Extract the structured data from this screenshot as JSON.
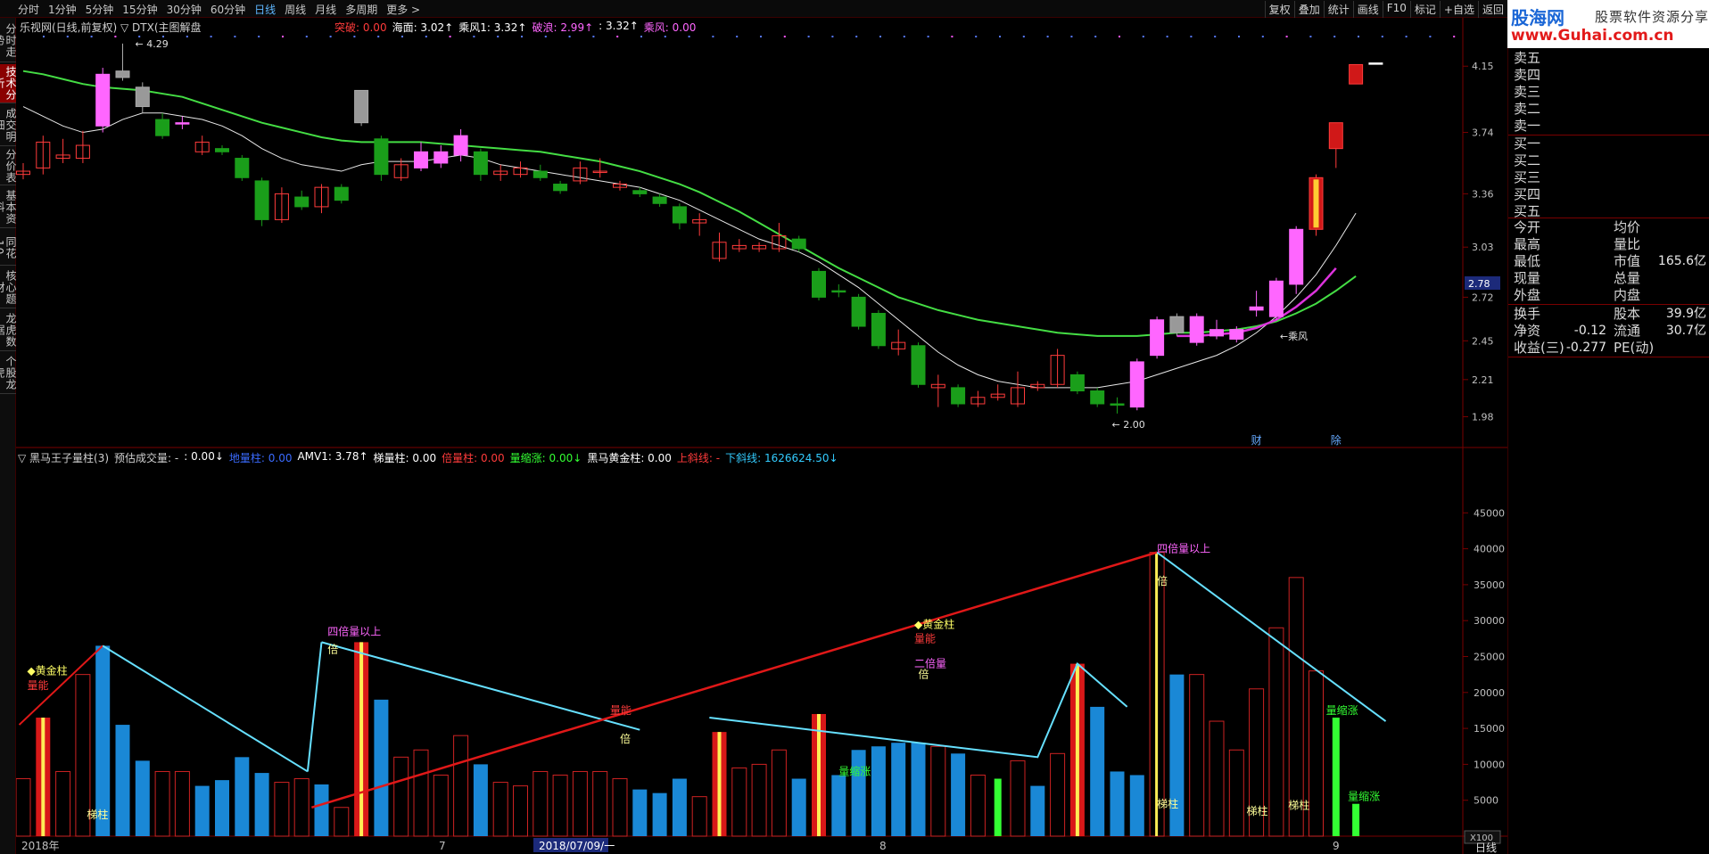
{
  "toolbar": {
    "periods": [
      "分时",
      "1分钟",
      "5分钟",
      "15分钟",
      "30分钟",
      "60分钟",
      "日线",
      "周线",
      "月线",
      "多周期",
      "更多 >"
    ],
    "active_period": "日线",
    "right": [
      "复权",
      "叠加",
      "统计",
      "画线",
      "F10",
      "标记",
      "+自选",
      "返回"
    ]
  },
  "logo": {
    "brand": "股海网",
    "sub": "股票软件资源分享",
    "url": "www.Guhai.com.cn"
  },
  "side_tabs": [
    "分时走势",
    "技术分析",
    "成交明细",
    "分价表",
    "基本资料",
    "同花10",
    "核心题材",
    "龙虎数据",
    "个股龙虎"
  ],
  "active_side_tab": "技术分析",
  "main": {
    "title": "乐视网(日线,前复权) ▽ DTX(主图解盘",
    "legend": [
      {
        "text": "突破: 0.00",
        "color": "#ff3b3b"
      },
      {
        "text": "海面: 3.02↑",
        "color": "#ffffff"
      },
      {
        "text": "乘风1: 3.32↑",
        "color": "#ffffff"
      },
      {
        "text": "破浪: 2.99↑",
        "color": "#ff66ff"
      },
      {
        "text": ": 3.32↑",
        "color": "#ffffff"
      },
      {
        "text": "乘风: 0.00",
        "color": "#ff66ff"
      }
    ],
    "high_label": "4.29",
    "low_label": "2.00",
    "chengfeng_label": "乘风",
    "markers": [
      "财",
      "除"
    ],
    "price_ticks": [
      "4.15",
      "3.74",
      "3.36",
      "3.03",
      "2.72",
      "2.45",
      "2.21",
      "1.98"
    ],
    "current_price": "2.78"
  },
  "sub": {
    "legend": [
      {
        "text": "▽ 黑马王子量柱(3)",
        "color": "#d0d0d0"
      },
      {
        "text": "预估成交量: -",
        "color": "#d0d0d0"
      },
      {
        "text": ": 0.00↓",
        "color": "#ffffff"
      },
      {
        "text": "地量柱: 0.00",
        "color": "#3a6bff"
      },
      {
        "text": "AMV1: 3.78↑",
        "color": "#ffffff"
      },
      {
        "text": "梯量柱: 0.00",
        "color": "#ffffff"
      },
      {
        "text": "倍量柱: 0.00",
        "color": "#ff3b3b"
      },
      {
        "text": "量缩涨: 0.00↓",
        "color": "#33ff33"
      },
      {
        "text": "黑马黄金柱: 0.00",
        "color": "#ffffff"
      },
      {
        "text": "上斜线: -",
        "color": "#ff3b3b"
      },
      {
        "text": "下斜线: 1626624.50↓",
        "color": "#33ccff"
      }
    ],
    "vol_ticks": [
      "45000",
      "40000",
      "35000",
      "30000",
      "25000",
      "20000",
      "15000",
      "10000",
      "5000"
    ],
    "unit": "X100",
    "annotations": [
      {
        "text": "◆黄金柱",
        "color": "#ffff66"
      },
      {
        "text": "量能",
        "color": "#ff3b3b"
      },
      {
        "text": "梯柱",
        "color": "#ffff99"
      },
      {
        "text": "四倍量以上",
        "color": "#ff66ff"
      },
      {
        "text": "倍",
        "color": "#ffff99"
      },
      {
        "text": "量能",
        "color": "#ff3b3b"
      },
      {
        "text": "倍",
        "color": "#ffff99"
      },
      {
        "text": "量缩涨",
        "color": "#33ff33"
      },
      {
        "text": "◆黄金柱",
        "color": "#ffff66"
      },
      {
        "text": "量能",
        "color": "#ff3b3b"
      },
      {
        "text": "二倍量",
        "color": "#ff66ff"
      },
      {
        "text": "倍",
        "color": "#ffff99"
      },
      {
        "text": "四倍量以上",
        "color": "#ff66ff"
      },
      {
        "text": "倍",
        "color": "#ffff99"
      },
      {
        "text": "梯柱",
        "color": "#ffff99"
      },
      {
        "text": "梯柱",
        "color": "#ffff99"
      },
      {
        "text": "梯柱",
        "color": "#ffff99"
      },
      {
        "text": "量缩涨",
        "color": "#33ff33"
      },
      {
        "text": "量缩涨",
        "color": "#33ff33"
      }
    ]
  },
  "date_axis": {
    "labels": [
      "2018年",
      "7",
      "2018/07/09/一",
      "8",
      "9"
    ],
    "corner": "日线"
  },
  "orderbook": {
    "asks": [
      "卖五",
      "卖四",
      "卖三",
      "卖二",
      "卖一"
    ],
    "bids": [
      "买一",
      "买二",
      "买三",
      "买四",
      "买五"
    ]
  },
  "stats": {
    "left_a": [
      "今开",
      "最高",
      "最低",
      "现量",
      "外盘"
    ],
    "right_a": [
      "均价",
      "量比",
      "市值",
      "总量",
      "内盘"
    ],
    "right_a_vals": [
      "",
      "",
      "165.6亿",
      "",
      ""
    ],
    "left_b": [
      "换手",
      "净资",
      "收益(三)"
    ],
    "left_b_vals": [
      "",
      "-0.12",
      "-0.277"
    ],
    "right_b": [
      "股本",
      "流通",
      "PE(动)"
    ],
    "right_b_vals": [
      "39.9亿",
      "30.7亿",
      ""
    ]
  },
  "colors": {
    "up": "#ff3b3b",
    "down": "#1a9e1a",
    "pink": "#ff66ff",
    "ma_green": "#44dd44",
    "ma_white": "#e8e8e8",
    "ma_pink": "#dd33dd",
    "vol_blue": "#1a88d6",
    "vol_red": "#cc2222",
    "trend_red": "#e01818",
    "trend_cyan": "#66e0ff"
  },
  "chart_data": {
    "type": "candlestick",
    "ylim": [
      1.9,
      4.35
    ],
    "candles": [
      {
        "o": 3.48,
        "c": 3.5,
        "h": 3.55,
        "l": 3.45,
        "t": "up"
      },
      {
        "o": 3.52,
        "c": 3.68,
        "h": 3.72,
        "l": 3.48,
        "t": "up"
      },
      {
        "o": 3.6,
        "c": 3.58,
        "h": 3.7,
        "l": 3.55,
        "t": "up"
      },
      {
        "o": 3.58,
        "c": 3.66,
        "h": 3.75,
        "l": 3.55,
        "t": "up"
      },
      {
        "o": 3.78,
        "c": 4.1,
        "h": 4.14,
        "l": 3.74,
        "t": "pink"
      },
      {
        "o": 4.08,
        "c": 4.12,
        "h": 4.29,
        "l": 4.06,
        "t": "gray"
      },
      {
        "o": 4.02,
        "c": 3.9,
        "h": 4.05,
        "l": 3.86,
        "t": "gray"
      },
      {
        "o": 3.82,
        "c": 3.72,
        "h": 3.86,
        "l": 3.7,
        "t": "down"
      },
      {
        "o": 3.8,
        "c": 3.8,
        "h": 3.84,
        "l": 3.76,
        "t": "pink"
      },
      {
        "o": 3.62,
        "c": 3.68,
        "h": 3.72,
        "l": 3.6,
        "t": "up"
      },
      {
        "o": 3.64,
        "c": 3.62,
        "h": 3.66,
        "l": 3.6,
        "t": "down"
      },
      {
        "o": 3.58,
        "c": 3.46,
        "h": 3.6,
        "l": 3.44,
        "t": "down"
      },
      {
        "o": 3.44,
        "c": 3.2,
        "h": 3.46,
        "l": 3.16,
        "t": "down"
      },
      {
        "o": 3.2,
        "c": 3.36,
        "h": 3.4,
        "l": 3.18,
        "t": "up"
      },
      {
        "o": 3.34,
        "c": 3.28,
        "h": 3.38,
        "l": 3.26,
        "t": "down"
      },
      {
        "o": 3.28,
        "c": 3.4,
        "h": 3.42,
        "l": 3.24,
        "t": "up"
      },
      {
        "o": 3.4,
        "c": 3.32,
        "h": 3.42,
        "l": 3.3,
        "t": "down"
      },
      {
        "o": 4.0,
        "c": 3.8,
        "h": 4.0,
        "l": 3.78,
        "t": "gray"
      },
      {
        "o": 3.7,
        "c": 3.48,
        "h": 3.72,
        "l": 3.44,
        "t": "down"
      },
      {
        "o": 3.46,
        "c": 3.54,
        "h": 3.58,
        "l": 3.44,
        "t": "up"
      },
      {
        "o": 3.52,
        "c": 3.62,
        "h": 3.68,
        "l": 3.5,
        "t": "pink"
      },
      {
        "o": 3.55,
        "c": 3.62,
        "h": 3.66,
        "l": 3.52,
        "t": "pink"
      },
      {
        "o": 3.6,
        "c": 3.72,
        "h": 3.76,
        "l": 3.56,
        "t": "pink"
      },
      {
        "o": 3.62,
        "c": 3.48,
        "h": 3.64,
        "l": 3.44,
        "t": "down"
      },
      {
        "o": 3.48,
        "c": 3.5,
        "h": 3.54,
        "l": 3.44,
        "t": "up"
      },
      {
        "o": 3.48,
        "c": 3.52,
        "h": 3.56,
        "l": 3.46,
        "t": "up"
      },
      {
        "o": 3.5,
        "c": 3.46,
        "h": 3.54,
        "l": 3.44,
        "t": "down"
      },
      {
        "o": 3.42,
        "c": 3.38,
        "h": 3.44,
        "l": 3.36,
        "t": "down"
      },
      {
        "o": 3.44,
        "c": 3.52,
        "h": 3.56,
        "l": 3.42,
        "t": "up"
      },
      {
        "o": 3.5,
        "c": 3.5,
        "h": 3.58,
        "l": 3.46,
        "t": "up"
      },
      {
        "o": 3.4,
        "c": 3.42,
        "h": 3.44,
        "l": 3.38,
        "t": "up"
      },
      {
        "o": 3.38,
        "c": 3.36,
        "h": 3.4,
        "l": 3.34,
        "t": "down"
      },
      {
        "o": 3.34,
        "c": 3.3,
        "h": 3.36,
        "l": 3.28,
        "t": "down"
      },
      {
        "o": 3.28,
        "c": 3.18,
        "h": 3.3,
        "l": 3.14,
        "t": "down"
      },
      {
        "o": 3.18,
        "c": 3.2,
        "h": 3.24,
        "l": 3.1,
        "t": "up"
      },
      {
        "o": 2.96,
        "c": 3.06,
        "h": 3.12,
        "l": 2.94,
        "t": "up"
      },
      {
        "o": 3.02,
        "c": 3.04,
        "h": 3.08,
        "l": 3.0,
        "t": "up"
      },
      {
        "o": 3.02,
        "c": 3.04,
        "h": 3.06,
        "l": 3.0,
        "t": "up"
      },
      {
        "o": 3.02,
        "c": 3.1,
        "h": 3.18,
        "l": 3.0,
        "t": "up"
      },
      {
        "o": 3.08,
        "c": 3.02,
        "h": 3.1,
        "l": 3.0,
        "t": "down"
      },
      {
        "o": 2.88,
        "c": 2.72,
        "h": 2.9,
        "l": 2.7,
        "t": "down"
      },
      {
        "o": 2.76,
        "c": 2.76,
        "h": 2.8,
        "l": 2.72,
        "t": "down"
      },
      {
        "o": 2.72,
        "c": 2.54,
        "h": 2.74,
        "l": 2.52,
        "t": "down"
      },
      {
        "o": 2.62,
        "c": 2.42,
        "h": 2.64,
        "l": 2.4,
        "t": "down"
      },
      {
        "o": 2.4,
        "c": 2.44,
        "h": 2.52,
        "l": 2.36,
        "t": "up"
      },
      {
        "o": 2.42,
        "c": 2.18,
        "h": 2.44,
        "l": 2.16,
        "t": "down"
      },
      {
        "o": 2.16,
        "c": 2.18,
        "h": 2.24,
        "l": 2.04,
        "t": "up"
      },
      {
        "o": 2.16,
        "c": 2.06,
        "h": 2.18,
        "l": 2.04,
        "t": "down"
      },
      {
        "o": 2.06,
        "c": 2.1,
        "h": 2.14,
        "l": 2.04,
        "t": "up"
      },
      {
        "o": 2.1,
        "c": 2.12,
        "h": 2.18,
        "l": 2.08,
        "t": "up"
      },
      {
        "o": 2.06,
        "c": 2.16,
        "h": 2.26,
        "l": 2.04,
        "t": "up"
      },
      {
        "o": 2.16,
        "c": 2.18,
        "h": 2.2,
        "l": 2.14,
        "t": "up"
      },
      {
        "o": 2.18,
        "c": 2.36,
        "h": 2.4,
        "l": 2.16,
        "t": "up"
      },
      {
        "o": 2.24,
        "c": 2.14,
        "h": 2.26,
        "l": 2.12,
        "t": "down"
      },
      {
        "o": 2.14,
        "c": 2.06,
        "h": 2.16,
        "l": 2.04,
        "t": "down"
      },
      {
        "o": 2.06,
        "c": 2.06,
        "h": 2.1,
        "l": 2.0,
        "t": "down"
      },
      {
        "o": 2.04,
        "c": 2.32,
        "h": 2.34,
        "l": 2.02,
        "t": "pink"
      },
      {
        "o": 2.36,
        "c": 2.58,
        "h": 2.6,
        "l": 2.34,
        "t": "pink"
      },
      {
        "o": 2.5,
        "c": 2.6,
        "h": 2.62,
        "l": 2.48,
        "t": "gray"
      },
      {
        "o": 2.44,
        "c": 2.6,
        "h": 2.62,
        "l": 2.42,
        "t": "pink"
      },
      {
        "o": 2.48,
        "c": 2.52,
        "h": 2.58,
        "l": 2.46,
        "t": "pink"
      },
      {
        "o": 2.46,
        "c": 2.52,
        "h": 2.54,
        "l": 2.44,
        "t": "pink"
      },
      {
        "o": 2.64,
        "c": 2.66,
        "h": 2.76,
        "l": 2.6,
        "t": "pink"
      },
      {
        "o": 2.6,
        "c": 2.82,
        "h": 2.84,
        "l": 2.58,
        "t": "pink"
      },
      {
        "o": 2.8,
        "c": 3.14,
        "h": 3.16,
        "l": 2.74,
        "t": "pink"
      },
      {
        "o": 3.14,
        "c": 3.46,
        "h": 3.48,
        "l": 3.1,
        "t": "yellowred"
      },
      {
        "o": 3.64,
        "c": 3.8,
        "h": 3.8,
        "l": 3.52,
        "t": "up_fill"
      },
      {
        "o": 4.04,
        "c": 4.16,
        "h": 4.16,
        "l": 4.04,
        "t": "up_fill"
      },
      {
        "o": 4.17,
        "c": 4.17,
        "h": 4.17,
        "l": 4.17,
        "t": "flat"
      }
    ],
    "ma_green": [
      4.12,
      4.1,
      4.07,
      4.04,
      4.02,
      4.01,
      4.0,
      3.98,
      3.96,
      3.92,
      3.88,
      3.84,
      3.8,
      3.77,
      3.74,
      3.71,
      3.69,
      3.68,
      3.68,
      3.68,
      3.68,
      3.67,
      3.66,
      3.65,
      3.64,
      3.63,
      3.62,
      3.6,
      3.58,
      3.56,
      3.53,
      3.5,
      3.46,
      3.42,
      3.37,
      3.31,
      3.25,
      3.18,
      3.11,
      3.04,
      2.97,
      2.9,
      2.84,
      2.78,
      2.72,
      2.68,
      2.64,
      2.61,
      2.58,
      2.56,
      2.54,
      2.52,
      2.5,
      2.49,
      2.48,
      2.48,
      2.48,
      2.49,
      2.5,
      2.5,
      2.51,
      2.52,
      2.54,
      2.57,
      2.62,
      2.68,
      2.76,
      2.85
    ],
    "ma_white": [
      3.9,
      3.84,
      3.78,
      3.74,
      3.76,
      3.82,
      3.86,
      3.86,
      3.84,
      3.82,
      3.78,
      3.72,
      3.64,
      3.58,
      3.54,
      3.52,
      3.5,
      3.54,
      3.56,
      3.56,
      3.56,
      3.58,
      3.6,
      3.58,
      3.54,
      3.52,
      3.5,
      3.48,
      3.46,
      3.44,
      3.42,
      3.4,
      3.36,
      3.32,
      3.26,
      3.2,
      3.14,
      3.08,
      3.04,
      3.0,
      2.94,
      2.86,
      2.78,
      2.68,
      2.58,
      2.48,
      2.38,
      2.3,
      2.24,
      2.2,
      2.18,
      2.16,
      2.16,
      2.16,
      2.16,
      2.18,
      2.2,
      2.24,
      2.28,
      2.32,
      2.36,
      2.42,
      2.5,
      2.6,
      2.72,
      2.86,
      3.04,
      3.24
    ],
    "ma_pink_start": 58,
    "ma_pink": [
      2.48,
      2.48,
      2.49,
      2.5,
      2.53,
      2.58,
      2.66,
      2.76,
      2.9
    ],
    "volumes": [
      {
        "v": 8000,
        "t": "r"
      },
      {
        "v": 16500,
        "t": "gold"
      },
      {
        "v": 9000,
        "t": "r"
      },
      {
        "v": 22500,
        "t": "r"
      },
      {
        "v": 26500,
        "t": "b"
      },
      {
        "v": 15500,
        "t": "b"
      },
      {
        "v": 10500,
        "t": "b"
      },
      {
        "v": 9000,
        "t": "r"
      },
      {
        "v": 9000,
        "t": "r"
      },
      {
        "v": 7000,
        "t": "b"
      },
      {
        "v": 7800,
        "t": "b"
      },
      {
        "v": 11000,
        "t": "b"
      },
      {
        "v": 8800,
        "t": "b"
      },
      {
        "v": 7500,
        "t": "r"
      },
      {
        "v": 8000,
        "t": "r"
      },
      {
        "v": 7200,
        "t": "b"
      },
      {
        "v": 4000,
        "t": "r"
      },
      {
        "v": 27000,
        "t": "gold"
      },
      {
        "v": 19000,
        "t": "b"
      },
      {
        "v": 11000,
        "t": "r"
      },
      {
        "v": 12000,
        "t": "r"
      },
      {
        "v": 8500,
        "t": "r"
      },
      {
        "v": 14000,
        "t": "r"
      },
      {
        "v": 10000,
        "t": "b"
      },
      {
        "v": 7500,
        "t": "r"
      },
      {
        "v": 7000,
        "t": "r"
      },
      {
        "v": 9000,
        "t": "r"
      },
      {
        "v": 8500,
        "t": "r"
      },
      {
        "v": 9000,
        "t": "r"
      },
      {
        "v": 9000,
        "t": "r"
      },
      {
        "v": 8000,
        "t": "r"
      },
      {
        "v": 6500,
        "t": "b"
      },
      {
        "v": 6000,
        "t": "b"
      },
      {
        "v": 8000,
        "t": "b"
      },
      {
        "v": 5500,
        "t": "r"
      },
      {
        "v": 14500,
        "t": "gold"
      },
      {
        "v": 9500,
        "t": "r"
      },
      {
        "v": 10000,
        "t": "r"
      },
      {
        "v": 12000,
        "t": "r"
      },
      {
        "v": 8000,
        "t": "b"
      },
      {
        "v": 17000,
        "t": "gold"
      },
      {
        "v": 8500,
        "t": "b"
      },
      {
        "v": 12000,
        "t": "b"
      },
      {
        "v": 12500,
        "t": "b"
      },
      {
        "v": 13000,
        "t": "b"
      },
      {
        "v": 13000,
        "t": "b"
      },
      {
        "v": 12500,
        "t": "r"
      },
      {
        "v": 11500,
        "t": "b"
      },
      {
        "v": 8500,
        "t": "r"
      },
      {
        "v": 8000,
        "t": "g"
      },
      {
        "v": 10500,
        "t": "r"
      },
      {
        "v": 7000,
        "t": "b"
      },
      {
        "v": 11500,
        "t": "r"
      },
      {
        "v": 24000,
        "t": "gold"
      },
      {
        "v": 18000,
        "t": "b"
      },
      {
        "v": 9000,
        "t": "b"
      },
      {
        "v": 8500,
        "t": "b"
      },
      {
        "v": 39500,
        "t": "gold_thin"
      },
      {
        "v": 22500,
        "t": "b"
      },
      {
        "v": 22500,
        "t": "r"
      },
      {
        "v": 16000,
        "t": "r"
      },
      {
        "v": 12000,
        "t": "r"
      },
      {
        "v": 20500,
        "t": "r"
      },
      {
        "v": 29000,
        "t": "r"
      },
      {
        "v": 36000,
        "t": "r"
      },
      {
        "v": 23000,
        "t": "r"
      },
      {
        "v": 16500,
        "t": "g"
      },
      {
        "v": 4500,
        "t": "g"
      }
    ],
    "vlim": [
      0,
      50000
    ]
  }
}
